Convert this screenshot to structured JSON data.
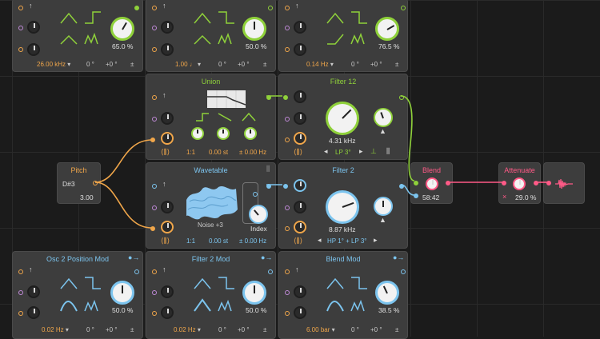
{
  "panels": {
    "top1": {
      "value": "65.0 %",
      "freq": "26.00",
      "unit": "kHz",
      "deg": "0 °",
      "offset": "+0 °",
      "pm": "±"
    },
    "top2": {
      "value": "50.0 %",
      "freq": "1.00",
      "unit": "♩",
      "deg": "0 °",
      "offset": "+0 °",
      "pm": "±"
    },
    "top3": {
      "value": "76.5 %",
      "freq": "0.14",
      "unit": "Hz",
      "deg": "0 °",
      "offset": "+0 °",
      "pm": "±"
    },
    "union": {
      "title": "Union",
      "ratio": "1:1",
      "st_val": "0.00",
      "st_unit": "st",
      "hz": "± 0.00 Hz"
    },
    "filter12": {
      "title": "Filter 12",
      "freq": "4.31 kHz",
      "mode": "LP 3°"
    },
    "pitch": {
      "title": "Pitch",
      "note": "D#3",
      "value": "3.00"
    },
    "wavetable": {
      "title": "Wavetable",
      "ratio": "1:1",
      "st_val": "0.00",
      "st_unit": "st",
      "hz": "± 0.00 Hz",
      "noise": "Noise +3",
      "index": "Index"
    },
    "filter2": {
      "title": "Filter 2",
      "freq": "8.87 kHz",
      "mode": "HP 1° + LP 3°"
    },
    "blend": {
      "title": "Blend",
      "value": "58:42"
    },
    "attenuate": {
      "title": "Attenuate",
      "value": "29.0 %"
    },
    "osc2mod": {
      "title": "Osc 2 Position Mod",
      "value": "50.0 %",
      "freq": "0.02",
      "unit": "Hz",
      "deg": "0 °",
      "offset": "+0 °",
      "pm": "±"
    },
    "filter2mod": {
      "title": "Filter 2 Mod",
      "value": "50.0 %",
      "freq": "0.02",
      "unit": "Hz",
      "deg": "0 °",
      "offset": "+0 °",
      "pm": "±"
    },
    "blendmod": {
      "title": "Blend Mod",
      "value": "38.5 %",
      "freq": "6.00",
      "unit": "bar",
      "deg": "0 °",
      "offset": "+0 °",
      "pm": "±"
    }
  },
  "colors": {
    "orange": "#f0a64a",
    "green": "#8fd13a",
    "blue": "#7cc4ee",
    "pink": "#ff5a87",
    "purple": "#c08ad8"
  },
  "icons": [
    "arrow-icon",
    "keyboard-icon",
    "waveform-icon",
    "spectrum-icon",
    "filter-response-icon"
  ]
}
